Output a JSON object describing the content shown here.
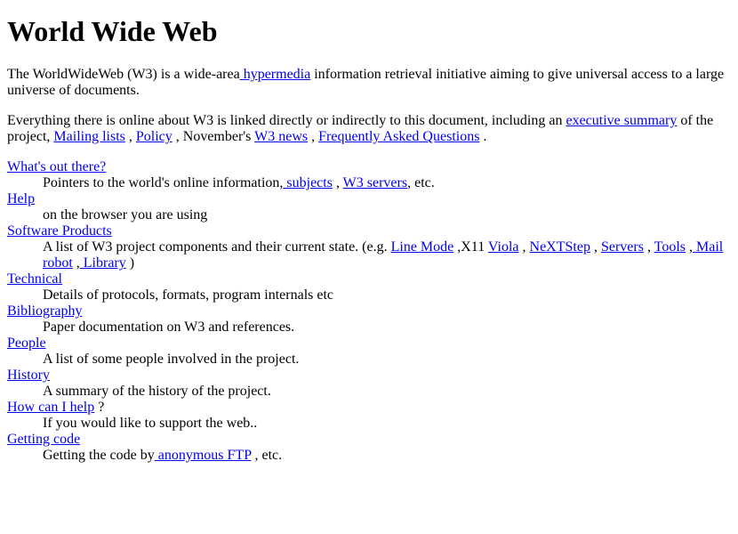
{
  "title": "World Wide Web",
  "link_color": "#0000ee",
  "intro": {
    "text_1": "The WorldWideWeb (W3) is a wide-area",
    "link_hypermedia": " hypermedia",
    "text_2": " information retrieval initiative aiming to give universal access to a large universe of documents."
  },
  "summary": {
    "text_1": "Everything there is online about W3 is linked directly or indirectly to this document, including an ",
    "link_executive_summary": "executive summary",
    "text_2": " of the project, ",
    "link_mailing_lists": "Mailing lists",
    "text_3": " , ",
    "link_policy": "Policy",
    "text_4": " , November's ",
    "link_w3_news": "W3 news",
    "text_5": " , ",
    "link_faq": "Frequently Asked Questions",
    "text_6": " ."
  },
  "items": [
    {
      "term": "What's out there?",
      "desc_1": "Pointers to the world's online information,",
      "link_subjects": " subjects",
      "desc_2": " , ",
      "link_servers": "W3 servers",
      "desc_3": ", etc."
    },
    {
      "term": "Help",
      "desc": "on the browser you are using"
    },
    {
      "term": "Software Products",
      "desc_1": "A list of W3 project components and their current state. (e.g. ",
      "links": [
        "Line Mode",
        "Viola",
        "NeXTStep",
        "Servers",
        "Tools",
        " Mail robot",
        " Library"
      ],
      "sep_x11": " ,X11 ",
      "sep": " , ",
      "desc_end": " )"
    },
    {
      "term": "Technical",
      "desc": "Details of protocols, formats, program internals etc"
    },
    {
      "term": "Bibliography",
      "desc": "Paper documentation on W3 and references."
    },
    {
      "term": "People",
      "desc": "A list of some people involved in the project."
    },
    {
      "term": "History",
      "desc": "A summary of the history of the project."
    },
    {
      "term": "How can I help",
      "term_suffix": " ?",
      "desc": "If you would like to support the web.."
    },
    {
      "term": "Getting code",
      "desc_1": "Getting the code by",
      "link_ftp": " anonymous FTP",
      "desc_2": " , etc."
    }
  ]
}
